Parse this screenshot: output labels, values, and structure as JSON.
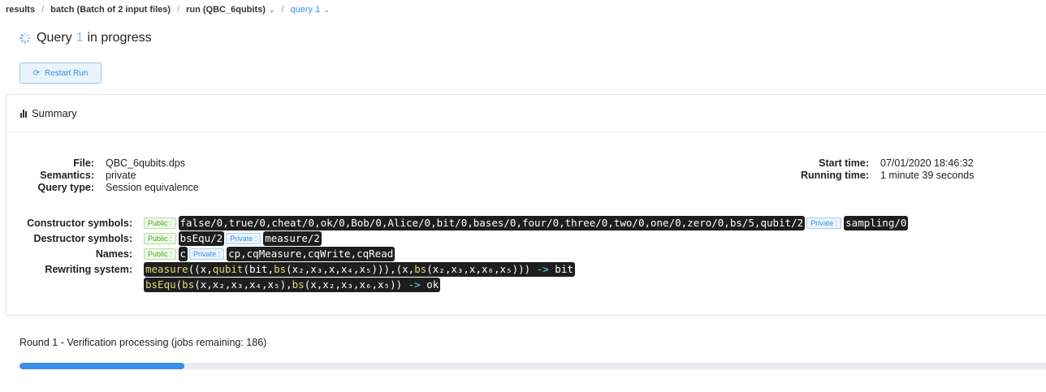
{
  "breadcrumb": [
    {
      "label": "results",
      "has_chevron": false
    },
    {
      "label": "batch (Batch of 2 input files)",
      "has_chevron": false
    },
    {
      "label": "run (QBC_6qubits)",
      "has_chevron": true
    },
    {
      "label": "query 1",
      "has_chevron": true
    }
  ],
  "title": {
    "prefix": "Query",
    "number": "1",
    "suffix": "in progress",
    "icon": "spinner-icon"
  },
  "restart_button": {
    "label": "Restart Run",
    "icon": "refresh-icon"
  },
  "summary": {
    "header": "Summary",
    "icon": "bar-chart-icon",
    "file_label": "File:",
    "file": "QBC_6qubits.dps",
    "semantics_label": "Semantics:",
    "semantics": "private",
    "query_type_label": "Query type:",
    "query_type": "Session equivalence",
    "start_time_label": "Start time:",
    "start_time": "07/01/2020 18:46:32",
    "running_time_label": "Running time:",
    "running_time": "1 minute 39 seconds",
    "constructor_label": "Constructor symbols:",
    "constructor_public_tag": "Public :",
    "constructor_public": "false/0,true/0,cheat/0,ok/0,Bob/0,Alice/0,bit/0,bases/0,four/0,three/0,two/0,one/0,zero/0,bs/5,qubit/2",
    "constructor_private_tag": "Private :",
    "constructor_private": "sampling/0",
    "destructor_label": "Destructor symbols:",
    "destructor_public_tag": "Public :",
    "destructor_public": "bsEqu/2",
    "destructor_private_tag": "Private :",
    "destructor_private": "measure/2",
    "names_label": "Names:",
    "names_public_tag": "Public :",
    "names_public": "c",
    "names_private_tag": "Private :",
    "names_private": "cp,cqMeasure,cqWrite,cqRead",
    "rewriting_label": "Rewriting system:",
    "rule1": {
      "fn1": "measure",
      "t1": "((x,",
      "fn2": "qubit",
      "t2": "(bit,",
      "fn3": "bs",
      "t3": "(x₂,x₃,x,x₄,x₅))),(x,",
      "fn4": "bs",
      "t4": "(x₂,x₃,x,x₆,x₅))) ",
      "arrow": "->",
      "result": " bit"
    },
    "rule2": {
      "fn1": "bsEqu",
      "t1": "(",
      "fn2": "bs",
      "t2": "(x,x₂,x₃,x₄,x₅),",
      "fn3": "bs",
      "t3": "(x,x₂,x₃,x₆,x₅)) ",
      "arrow": "->",
      "result": " ok"
    }
  },
  "round": {
    "text": "Round 1 - Verification processing (jobs remaining: 186)",
    "progress": 0.16
  },
  "colors": {
    "accent": "#3a8ee6",
    "public": "#52a62f",
    "code_bg": "#1e1e1e",
    "code_fn": "#e6db74"
  }
}
